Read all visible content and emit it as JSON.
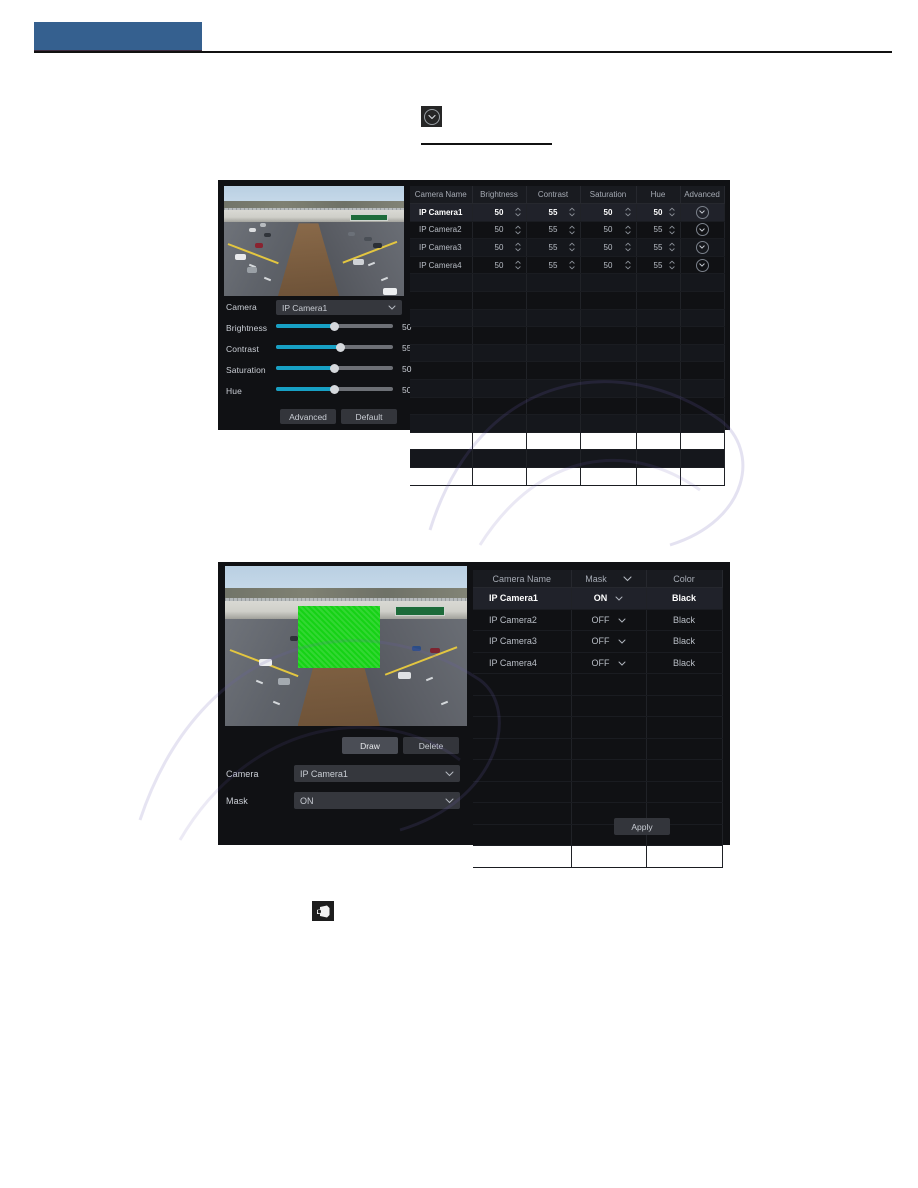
{
  "page": {
    "header_block_color": "#35608f",
    "background": "#ffffff"
  },
  "figure_icons": {
    "dropdown_button": "chevron-down-circle-icon",
    "camera_button": "camera-icon"
  },
  "image_adjust_panel": {
    "preview": {
      "scene": "highway with overpass bridge",
      "sign_text": ""
    },
    "controls": {
      "camera_label": "Camera",
      "camera_value": "IP Camera1",
      "sliders": [
        {
          "label": "Brightness",
          "value": "50",
          "percent": 50
        },
        {
          "label": "Contrast",
          "value": "55",
          "percent": 55
        },
        {
          "label": "Saturation",
          "value": "50",
          "percent": 50
        },
        {
          "label": "Hue",
          "value": "50",
          "percent": 50
        }
      ],
      "advanced_button": "Advanced",
      "default_button": "Default"
    },
    "table": {
      "headers": [
        "Camera Name",
        "Brightness",
        "Contrast",
        "Saturation",
        "Hue",
        "Advanced"
      ],
      "rows": [
        {
          "name": "IP Camera1",
          "brightness": "50",
          "contrast": "55",
          "saturation": "50",
          "hue": "50",
          "advanced": "chevron-down-icon",
          "selected": true
        },
        {
          "name": "IP Camera2",
          "brightness": "50",
          "contrast": "55",
          "saturation": "50",
          "hue": "55",
          "advanced": "chevron-down-icon",
          "selected": false
        },
        {
          "name": "IP Camera3",
          "brightness": "50",
          "contrast": "55",
          "saturation": "50",
          "hue": "55",
          "advanced": "chevron-down-icon",
          "selected": false
        },
        {
          "name": "IP Camera4",
          "brightness": "50",
          "contrast": "55",
          "saturation": "50",
          "hue": "55",
          "advanced": "chevron-down-icon",
          "selected": false
        }
      ],
      "empty_rows": 12
    }
  },
  "privacy_mask_panel": {
    "preview": {
      "scene": "highway with overpass bridge",
      "mask_color": "#16d216"
    },
    "controls": {
      "draw_button": "Draw",
      "delete_button": "Delete",
      "camera_label": "Camera",
      "camera_value": "IP Camera1",
      "mask_label": "Mask",
      "mask_value": "ON"
    },
    "table": {
      "headers": [
        "Camera Name",
        "Mask",
        "Color"
      ],
      "header_mask_icon": "chevron-down-icon",
      "rows": [
        {
          "name": "IP Camera1",
          "mask": "ON",
          "color": "Black",
          "selected": true
        },
        {
          "name": "IP Camera2",
          "mask": "OFF",
          "color": "Black",
          "selected": false
        },
        {
          "name": "IP Camera3",
          "mask": "OFF",
          "color": "Black",
          "selected": false
        },
        {
          "name": "IP Camera4",
          "mask": "OFF",
          "color": "Black",
          "selected": false
        }
      ],
      "empty_rows": 9
    },
    "apply_button": "Apply"
  },
  "colors": {
    "panel_bg": "#101114",
    "slider_fill": "#17a0c4",
    "slider_track": "#6d7076",
    "accent_blue": "#35608f",
    "mask_green": "#16d216"
  }
}
